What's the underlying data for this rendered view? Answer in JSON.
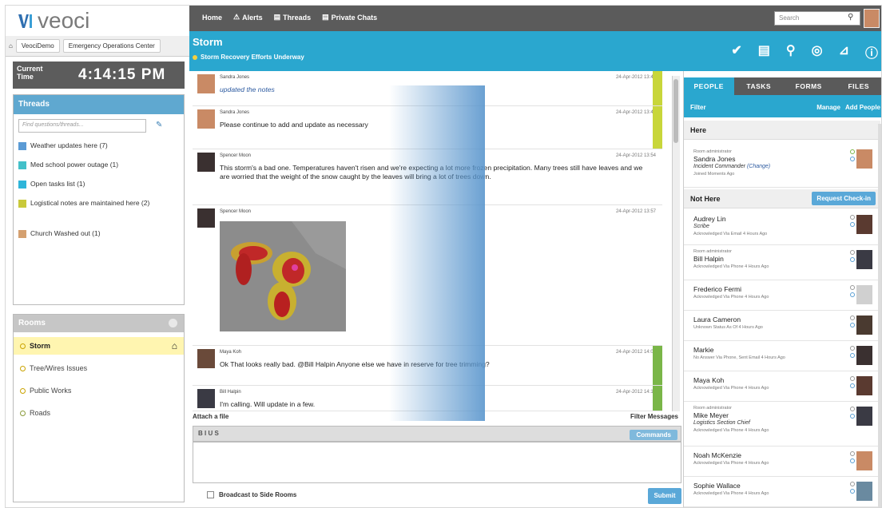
{
  "logo": {
    "text": "veoci"
  },
  "topnav": {
    "home": "Home",
    "alerts": "Alerts",
    "threads": "Threads",
    "private_chats": "Private Chats",
    "search_placeholder": "Search"
  },
  "breadcrumb": {
    "items": [
      "VeociDemo",
      "Emergency Operations Center"
    ]
  },
  "clock": {
    "label": "Current Time",
    "time": "4:14:15 PM"
  },
  "threads": {
    "title": "Threads",
    "search_placeholder": "Find questions/threads...",
    "items": [
      {
        "label": "Weather updates here (7)",
        "color": "#5b9bd5"
      },
      {
        "label": "Med school power outage (1)",
        "color": "#43c0c9"
      },
      {
        "label": "Open tasks list (1)",
        "color": "#2eb5d9"
      },
      {
        "label": "Logistical notes are maintained here (2)",
        "color": "#c9c93a"
      },
      {
        "label": "Church Washed out (1)",
        "color": "#d4a070"
      }
    ]
  },
  "rooms": {
    "title": "Rooms",
    "items": [
      {
        "label": "Storm",
        "selected": true
      },
      {
        "label": "Tree/Wires Issues"
      },
      {
        "label": "Public Works"
      },
      {
        "label": "Roads"
      }
    ]
  },
  "room": {
    "title": "Storm",
    "subtitle": "Storm Recovery Efforts Underway"
  },
  "messages": [
    {
      "name": "Sandra Jones",
      "time": "24-Apr-2012 13:41",
      "text": "updated the notes",
      "italic": true,
      "flag": "#c8d63a"
    },
    {
      "name": "Sandra Jones",
      "time": "24-Apr-2012 13:43",
      "text": "Please continue to add and update as necessary",
      "flag": "#c8d63a"
    },
    {
      "name": "Spencer Moon",
      "time": "24-Apr-2012 13:54",
      "text": "This storm's a bad one. Temperatures haven't risen and we're expecting a lot more frozen precipitation. Many trees still have leaves and we are worried that the weight of the snow caught by the leaves will bring a lot of trees down.",
      "flag": ""
    },
    {
      "name": "Spencer Moon",
      "time": "24-Apr-2012 13:57",
      "text": "",
      "flag": ""
    },
    {
      "name": "Maya Koh",
      "time": "24-Apr-2012 14:03",
      "text": "Ok That looks really bad.  @Bill Halpin Anyone else we have in reserve for tree trimming?",
      "flag": "#7ab648"
    },
    {
      "name": "Bill Halpin",
      "time": "24-Apr-2012 14:10",
      "text": "I'm calling.  Will update in a few.",
      "flag": "#7ab648"
    }
  ],
  "compose": {
    "attach": "Attach a file",
    "filter": "Filter Messages",
    "commands": "Commands",
    "broadcast": "Broadcast to Side Rooms",
    "submit": "Submit"
  },
  "panel": {
    "tabs": [
      "PEOPLE",
      "TASKS",
      "FORMS",
      "FILES"
    ],
    "filter": "Filter",
    "manage": "Manage",
    "add_people": "Add People",
    "here_title": "Here",
    "not_here_title": "Not Here",
    "request_checkin": "Request Check-in",
    "here": [
      {
        "role": "Room administrator",
        "name": "Sandra Jones",
        "sub": "Incident Commander",
        "change": "(Change)",
        "status": "Joined Moments Ago"
      }
    ],
    "not_here": [
      {
        "role": "",
        "name": "Audrey Lin",
        "sub": "Scribe",
        "status": "Acknowledged Via Email 4 Hours Ago"
      },
      {
        "role": "Room administrator",
        "name": "Bill Halpin",
        "sub": "",
        "status": "Acknowledged Via Phone 4 Hours Ago"
      },
      {
        "role": "",
        "name": "Frederico Fermi",
        "sub": "",
        "status": "Acknowledged Via Phone 4 Hours Ago"
      },
      {
        "role": "",
        "name": "Laura Cameron",
        "sub": "",
        "status": "Unknown Status As Of 4 Hours Ago"
      },
      {
        "role": "",
        "name": "Markie",
        "sub": "",
        "status": "No Answer Via Phone, Sent Email 4 Hours Ago"
      },
      {
        "role": "",
        "name": "Maya Koh",
        "sub": "",
        "status": "Acknowledged Via Phone 4 Hours Ago"
      },
      {
        "role": "Room administrator",
        "name": "Mike Meyer",
        "sub": "Logistics Section Chief",
        "status": "Acknowledged Via Phone 4 Hours Ago"
      },
      {
        "role": "",
        "name": "Noah McKenzie",
        "sub": "",
        "status": "Acknowledged Via Phone 4 Hours Ago"
      },
      {
        "role": "",
        "name": "Sophie Wallace",
        "sub": "",
        "status": "Acknowledged Via Phone 4 Hours Ago"
      }
    ]
  },
  "colors": {
    "accent": "#2aa7cf",
    "topbar": "#5b5b5b",
    "threads_header": "#5fa8d0"
  }
}
